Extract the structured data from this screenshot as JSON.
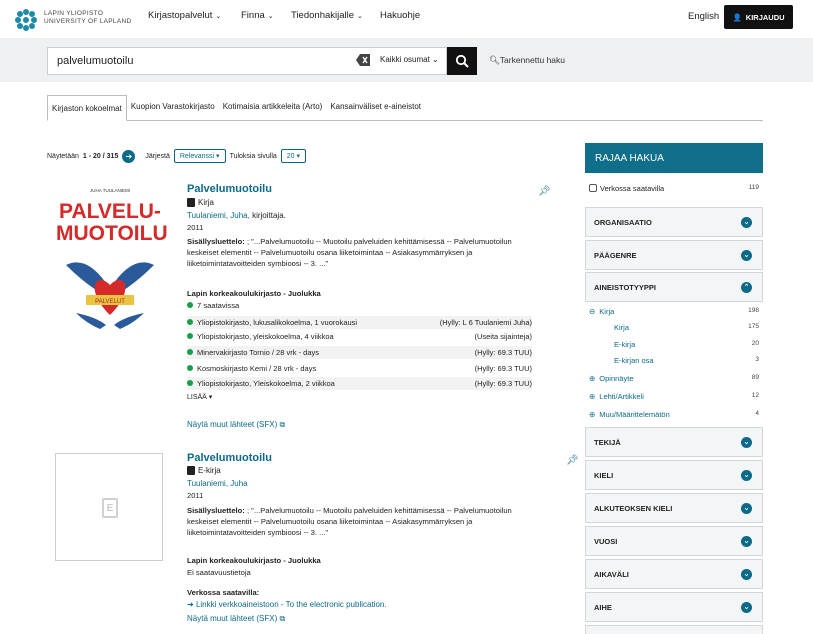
{
  "header": {
    "logo_line1": "LAPIN YLIOPISTO",
    "logo_line2": "UNIVERSITY OF LAPLAND",
    "nav": [
      "Kirjastopalvelut",
      "Finna",
      "Tiedonhakijalle",
      "Hakuohje"
    ],
    "language": "English",
    "login": "KIRJAUDU"
  },
  "search": {
    "query": "palvelumuotoilu",
    "scope": "Kaikki osumat",
    "advanced": "Tarkennettu haku"
  },
  "tabs": [
    "Kirjaston kokoelmat",
    "Kuopion Varastokirjasto",
    "Kotimaisia artikkeleita (Arto)",
    "Kansainväliset e-aineistot"
  ],
  "toolbar": {
    "showing_prefix": "Näytetään",
    "showing_range": "1 - 20 / 315",
    "sort_label": "Järjestä",
    "sort_value": "Relevanssi",
    "per_page_label": "Tuloksia sivulla",
    "per_page_value": "20"
  },
  "records": [
    {
      "cover_author": "JUHA TUULANIEMI",
      "cover_title1": "PALVELU-",
      "cover_title2": "MUOTOILU",
      "cover_banner": "PALVELUT",
      "title": "Palvelumuotoilu",
      "format": "Kirja",
      "author": "Tuulaniemi, Juha,",
      "author_role": " kirjoittaja.",
      "year": "2011",
      "toc_label": "Sisällysluettelo:",
      "toc_text": "; \"...Palvelumuotoilu -- Muotoilu palveluiden kehittämisessä -- Palvelumuotoilun keskeiset elementit -- Palvelumuotoilu osana liiketoimintaa -- Asiakasymmärryksen ja liiketoimintatavoitteiden symbioosi -- 3. ...\"",
      "library": "Lapin korkeakoulukirjasto - Juolukka",
      "available": "7 saatavissa",
      "holdings": [
        {
          "loc": "Yliopistokirjasto, lukusalikokoelma, 1 vuorokausi",
          "shelf": "(Hylly: L 6 Tuulaniemi Juha)"
        },
        {
          "loc": "Yliopistokirjasto, yleiskokoelma, 4 viikkoa",
          "shelf": "(Useita sijainteja)"
        },
        {
          "loc": "Minervakirjasto Tornio / 28 vrk - days",
          "shelf": "(Hylly: 69.3 TUU)"
        },
        {
          "loc": "Kosmoskirjasto Kemi / 28 vrk - days",
          "shelf": "(Hylly: 69.3 TUU)"
        },
        {
          "loc": "Yliopistokirjasto, Yleiskokoelma, 2 viikkoa",
          "shelf": "(Hylly: 69.3 TUU)"
        }
      ],
      "more": "LISÄÄ ▾",
      "sfx": "Näytä muut lähteet (SFX)"
    },
    {
      "title": "Palvelumuotoilu",
      "format": "E-kirja",
      "author": "Tuulaniemi, Juha",
      "year": "2011",
      "toc_label": "Sisällysluettelo:",
      "toc_text": "; \"...Palvelumuotoilu -- Muotoilu palveluiden kehittämisessä -- Palvelumuotoilun keskeiset elementit -- Palvelumuotoilu osana liiketoimintaa -- Asiakasymmärryksen ja liiketoimintatavoitteiden symbioosi -- 3. ...\"",
      "library": "Lapin korkeakoulukirjasto - Juolukka",
      "availability": "Ei saatavuustietoja",
      "online_label": "Verkossa saatavilla:",
      "online_link": "Linkki verkkoaineistoon - To the electronic publication.",
      "sfx": "Näytä muut lähteet (SFX)"
    }
  ],
  "facets": {
    "heading": "RAJAA HAKUA",
    "online_only": "Verkossa saatavilla",
    "online_count": "119",
    "groups_top": [
      "ORGANISAATIO",
      "PÄÄGENRE"
    ],
    "open_group": "AINEISTOTYYPPI",
    "open_items": [
      {
        "label": "Kirja",
        "count": "198",
        "sym": "⊖",
        "indent": 0
      },
      {
        "label": "Kirja",
        "count": "175",
        "sym": "",
        "indent": 1
      },
      {
        "label": "E-kirja",
        "count": "20",
        "sym": "",
        "indent": 1
      },
      {
        "label": "E-kirjan osa",
        "count": "3",
        "sym": "",
        "indent": 1
      },
      {
        "label": "Opinnäyte",
        "count": "89",
        "sym": "⊕",
        "indent": 0
      },
      {
        "label": "Lehti/Artikkeli",
        "count": "12",
        "sym": "⊕",
        "indent": 0
      },
      {
        "label": "Muu/Määrittelemätön",
        "count": "4",
        "sym": "⊕",
        "indent": 0
      }
    ],
    "groups_bottom": [
      "TEKIJÄ",
      "KIELI",
      "ALKUTEOKSEN KIELI",
      "VUOSI",
      "AIKAVÄLI",
      "AIHE"
    ]
  }
}
